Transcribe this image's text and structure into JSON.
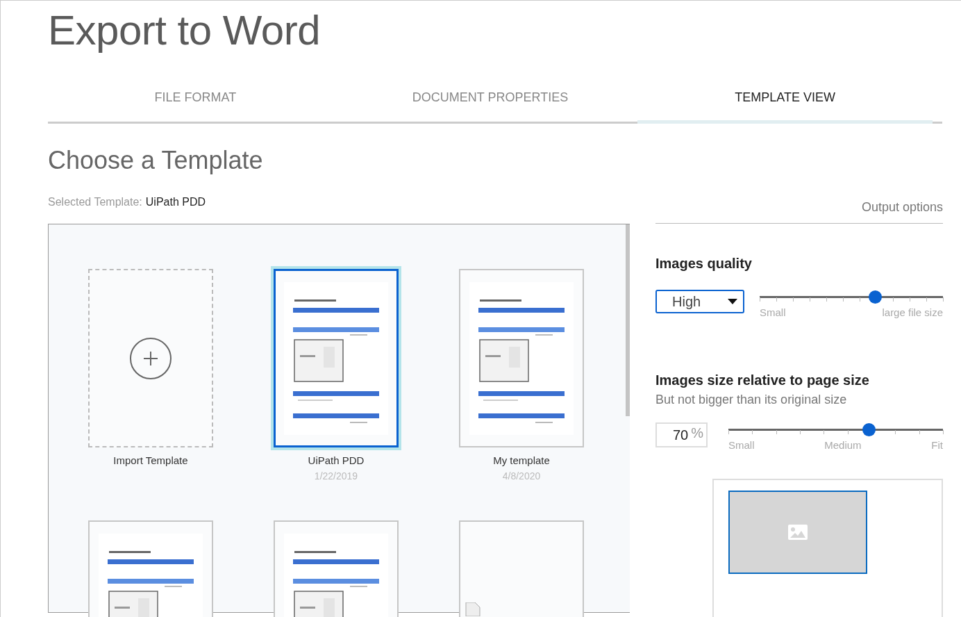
{
  "title": "Export to Word",
  "tabs": [
    {
      "label": "FILE FORMAT",
      "selected": false
    },
    {
      "label": "DOCUMENT PROPERTIES",
      "selected": false
    },
    {
      "label": "TEMPLATE VIEW",
      "selected": true
    }
  ],
  "section_title": "Choose a Template",
  "selected_template": {
    "label": "Selected Template:",
    "value": "UiPath PDD"
  },
  "output_options_label": "Output options",
  "templates": [
    {
      "kind": "import",
      "name": "Import Template",
      "selected": false
    },
    {
      "kind": "document",
      "name": "UiPath PDD",
      "date": "1/22/2019",
      "selected": true
    },
    {
      "kind": "document",
      "name": "My template",
      "date": "4/8/2020",
      "selected": false
    },
    {
      "kind": "document",
      "selected": false
    },
    {
      "kind": "document",
      "selected": false
    },
    {
      "kind": "blank",
      "selected": false
    }
  ],
  "images_quality": {
    "title": "Images quality",
    "value": "High",
    "level": 0.63,
    "min_label": "Small",
    "max_label": "large file size"
  },
  "images_size": {
    "title": "Images size relative to page size",
    "subtitle": "But not bigger than its original size",
    "value": "70",
    "unit": "%",
    "level": 0.655,
    "labels": [
      "Small",
      "Medium",
      "Fit"
    ]
  }
}
